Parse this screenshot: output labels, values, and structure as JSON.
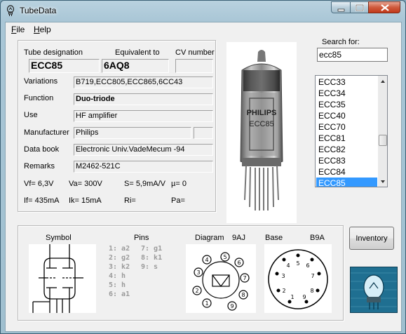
{
  "window": {
    "title": "TubeData"
  },
  "menu": {
    "file": "File",
    "help": "Help"
  },
  "tube": {
    "designation_label": "Tube designation",
    "equivalent_label": "Equivalent to",
    "cv_label": "CV number",
    "designation": "ECC85",
    "equivalent": "6AQ8",
    "cv_number": "",
    "variations_label": "Variations",
    "variations": "B719,ECC805,ECC865,6CC43",
    "function_label": "Function",
    "function": "Duo-triode",
    "use_label": "Use",
    "use": "HF amplifier",
    "manufacturer_label": "Manufacturer",
    "manufacturer": "Philips",
    "databook_label": "Data book",
    "databook": "Electronic Univ.VadeMecum -94",
    "remarks_label": "Remarks",
    "remarks": "M2462-521C",
    "vf": "Vf= 6,3V",
    "va": "Va=  300V",
    "s": "S= 5,9mA/V",
    "mu": "µ=    0",
    "if": "If= 435mA",
    "ik": "Ik=   15mA",
    "ri": "Ri=",
    "pa": "Pa="
  },
  "photo": {
    "brand": "PHILIPS",
    "type": "ECC85"
  },
  "search": {
    "label": "Search for:",
    "value": "ecc85"
  },
  "list": {
    "items": [
      "ECC33",
      "ECC34",
      "ECC35",
      "ECC40",
      "ECC70",
      "ECC81",
      "ECC82",
      "ECC83",
      "ECC84",
      "ECC85"
    ],
    "selected": "ECC85"
  },
  "bottom": {
    "symbol_label": "Symbol",
    "pins_label": "Pins",
    "diagram_label": "Diagram",
    "diagram_code": "9AJ",
    "base_label": "Base",
    "base_code": "B9A",
    "pins_col1": [
      "1: a2",
      "2: g2",
      "3: k2",
      "4: h",
      "5: h",
      "6: a1"
    ],
    "pins_col2": [
      "7: g1",
      "8: k1",
      "9: s"
    ],
    "inventory_label": "Inventory"
  },
  "colors": {
    "selection": "#3399ff",
    "title_bar": "#a9c6d6",
    "client": "#f0f0f0"
  }
}
